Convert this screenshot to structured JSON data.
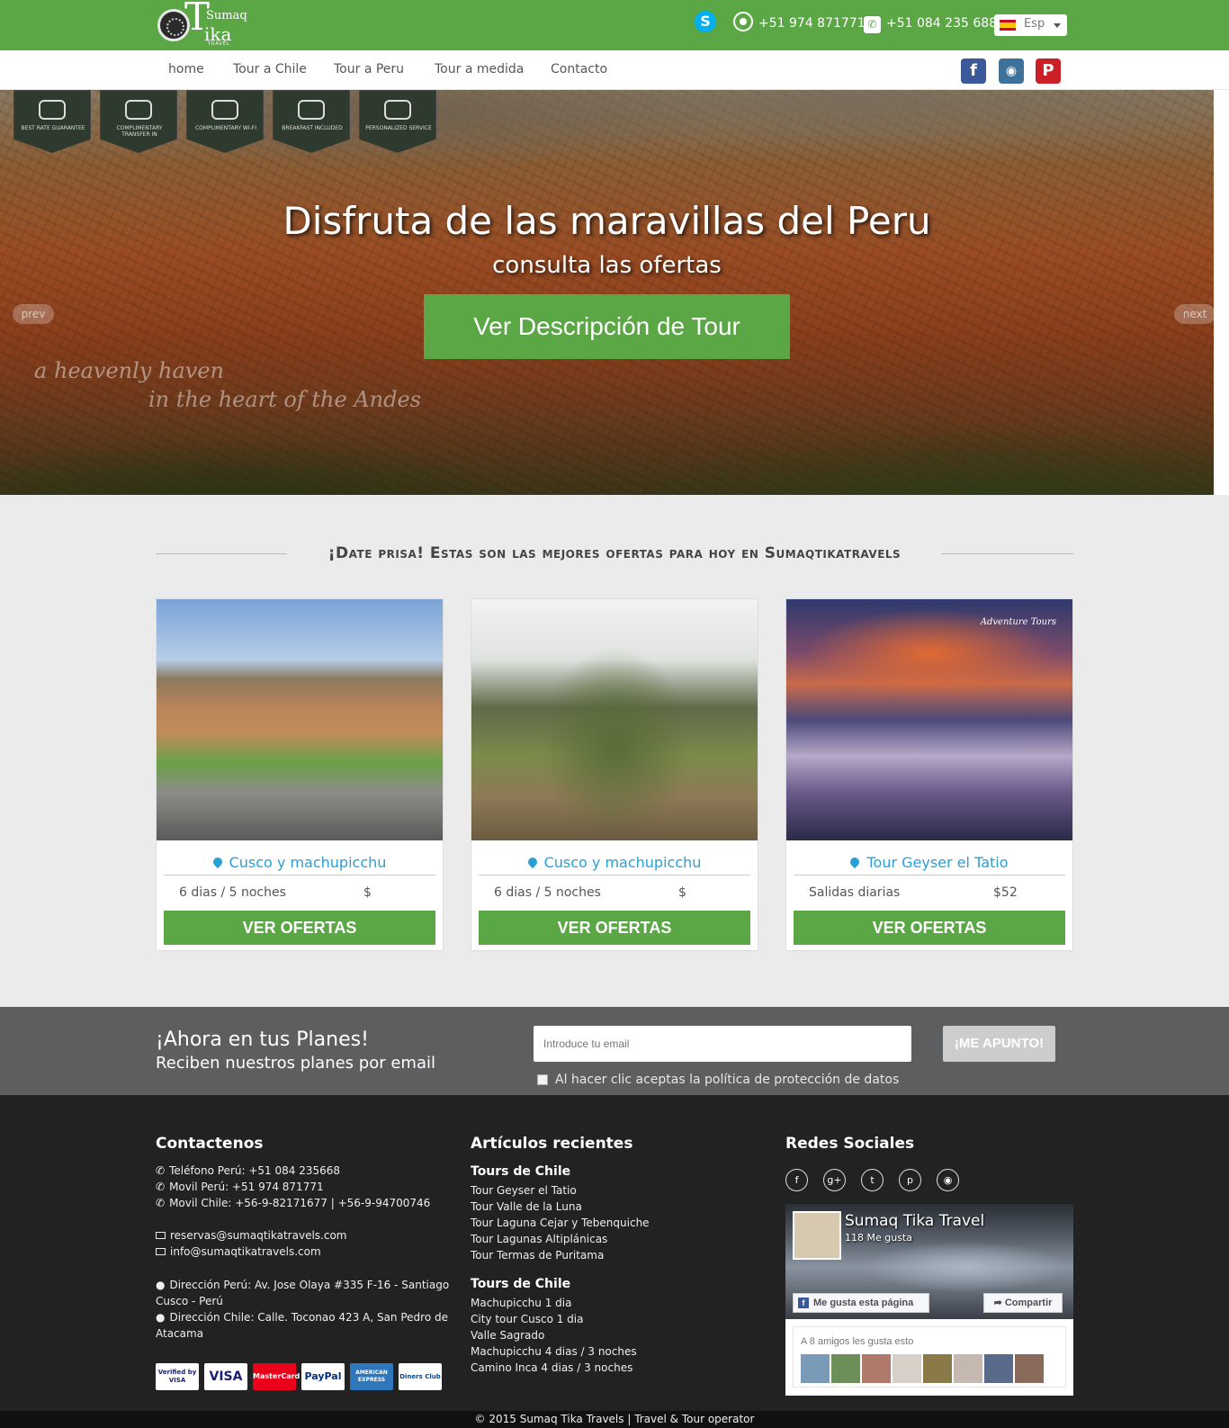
{
  "header": {
    "brand": {
      "top": "Sumaq",
      "letter": "T",
      "bottom": "ika",
      "tag": "TRAVEL"
    },
    "skype_icon": "skype-icon",
    "whatsapp_phone": "+51 974 871771",
    "phone": "+51 084 235 688",
    "language": "Esp"
  },
  "nav": {
    "items": [
      "home",
      "Tour a Chile",
      "Tour a Peru",
      "Tour a medida",
      "Contacto"
    ],
    "social_icons": [
      "facebook-icon",
      "instagram-icon",
      "pinterest-icon"
    ]
  },
  "hero": {
    "badges": [
      {
        "icon": "medal-icon",
        "label": "BEST RATE GUARANTEE"
      },
      {
        "icon": "car-icon",
        "label": "COMPLIMENTARY TRANSFER IN"
      },
      {
        "icon": "wifi-icon",
        "label": "COMPLIMENTARY WI-FI"
      },
      {
        "icon": "coffee-icon",
        "label": "BREAKFAST INCLUDED"
      },
      {
        "icon": "crown-icon",
        "label": "PERSONALIZED SERVICE"
      }
    ],
    "title": "Disfruta de las maravillas del Peru",
    "subtitle": "consulta las ofertas",
    "cta": "Ver Descripción de Tour",
    "prev": "prev",
    "next": "next",
    "script_line1": "a heavenly haven",
    "script_line2": "in the heart of the Andes"
  },
  "offers": {
    "heading": "¡Date prisa! Estas son las mejores ofertas para hoy en Sumaqtikatravels",
    "cards": [
      {
        "location": "Cusco y machupicchu",
        "duration": "6 dias / 5 noches",
        "price": "$",
        "button": "VER OFERTAS"
      },
      {
        "location": "Cusco y machupicchu",
        "duration": "6 dias / 5 noches",
        "price": "$",
        "button": "VER OFERTAS"
      },
      {
        "location": "Tour Geyser el Tatio",
        "duration": "Salidas diarias",
        "price": "$52",
        "button": "VER OFERTAS",
        "image_label": "Adventure Tours"
      }
    ]
  },
  "newsletter": {
    "title": "¡Ahora en tus Planes!",
    "subtitle": "Reciben nuestros planes por email",
    "placeholder": "Introduce tu email",
    "button": "¡ME APUNTO!",
    "terms": "Al hacer clic aceptas la política de protección de datos"
  },
  "footer": {
    "contact": {
      "heading": "Contactenos",
      "phone_peru": "Teléfono Perú: +51 084 235668",
      "mobile_peru": "Movil Perú: +51 974 871771",
      "mobile_chile": "Movil Chile: +56-9-82171677 | +56-9-94700746",
      "email1": "reservas@sumaqtikatravels.com",
      "email2": "info@sumaqtikatravels.com",
      "addr_peru_1": "Dirección Perú: Av. Jose Olaya #335 F-16 - Santiago",
      "addr_peru_2": "Cusco - Perú",
      "addr_chile_1": "Dirección Chile: Calle. Toconao 423 A, San Pedro de",
      "addr_chile_2": "Atacama",
      "payments": [
        "Verified by VISA",
        "VISA",
        "MasterCard",
        "PayPal",
        "AMERICAN EXPRESS",
        "Diners Club"
      ]
    },
    "articles": {
      "heading": "Artículos recientes",
      "group1": {
        "title": "Tours de Chile",
        "items": [
          "Tour Geyser el Tatio",
          "Tour Valle de la Luna",
          "Tour Laguna Cejar y Tebenquiche",
          "Tour Lagunas Altiplánicas",
          "Tour Termas de Puritama"
        ]
      },
      "group2": {
        "title": "Tours de Chile",
        "items": [
          "Machupicchu 1 dia",
          "City tour Cusco 1 dia",
          "Valle Sagrado",
          "Machupicchu 4 dias / 3 noches",
          "Camino Inca 4 dias / 3 noches"
        ]
      }
    },
    "social": {
      "heading": "Redes Sociales",
      "icons": [
        "facebook-icon",
        "google-plus-icon",
        "twitter-icon",
        "pinterest-icon",
        "instagram-icon"
      ],
      "fb_name": "Sumaq Tika Travel",
      "fb_likes": "118 Me gusta",
      "fb_like_btn": "Me gusta esta página",
      "fb_share_btn": "Compartir",
      "fb_friends": "A 8 amigos les gusta esto"
    }
  },
  "copyright": "© 2015 Sumaq Tika Travels | Travel & Tour operator"
}
